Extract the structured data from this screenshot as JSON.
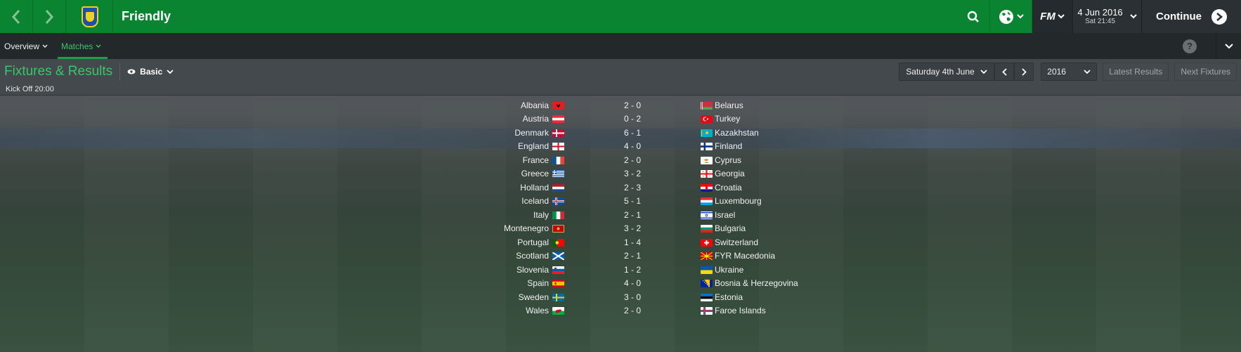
{
  "header": {
    "title": "Friendly",
    "brand": "FM",
    "date": "4 Jun 2016",
    "day_time": "Sat 21:45",
    "continue_label": "Continue",
    "accent": "#0a8431"
  },
  "subnav": {
    "tabs": [
      {
        "label": "Overview",
        "active": false
      },
      {
        "label": "Matches",
        "active": true
      }
    ],
    "help": "?"
  },
  "toolbar": {
    "title": "Fixtures & Results",
    "view_label": "Basic",
    "date_select": "Saturday 4th June",
    "year_select": "2016",
    "latest_results": "Latest Results",
    "next_fixtures": "Next Fixtures"
  },
  "kickoff_label": "Kick Off 20:00",
  "fixtures": [
    {
      "home": "Albania",
      "home_flag": "albania",
      "score": "2 - 0",
      "away": "Belarus",
      "away_flag": "belarus"
    },
    {
      "home": "Austria",
      "home_flag": "austria",
      "score": "0 - 2",
      "away": "Turkey",
      "away_flag": "turkey"
    },
    {
      "home": "Denmark",
      "home_flag": "denmark",
      "score": "6 - 1",
      "away": "Kazakhstan",
      "away_flag": "kazakhstan"
    },
    {
      "home": "England",
      "home_flag": "england",
      "score": "4 - 0",
      "away": "Finland",
      "away_flag": "finland"
    },
    {
      "home": "France",
      "home_flag": "france",
      "score": "2 - 0",
      "away": "Cyprus",
      "away_flag": "cyprus"
    },
    {
      "home": "Greece",
      "home_flag": "greece",
      "score": "3 - 2",
      "away": "Georgia",
      "away_flag": "georgia"
    },
    {
      "home": "Holland",
      "home_flag": "holland",
      "score": "2 - 3",
      "away": "Croatia",
      "away_flag": "croatia"
    },
    {
      "home": "Iceland",
      "home_flag": "iceland",
      "score": "5 - 1",
      "away": "Luxembourg",
      "away_flag": "luxembourg"
    },
    {
      "home": "Italy",
      "home_flag": "italy",
      "score": "2 - 1",
      "away": "Israel",
      "away_flag": "israel"
    },
    {
      "home": "Montenegro",
      "home_flag": "montenegro",
      "score": "3 - 2",
      "away": "Bulgaria",
      "away_flag": "bulgaria"
    },
    {
      "home": "Portugal",
      "home_flag": "portugal",
      "score": "1 - 4",
      "away": "Switzerland",
      "away_flag": "switzerland"
    },
    {
      "home": "Scotland",
      "home_flag": "scotland",
      "score": "2 - 1",
      "away": "FYR Macedonia",
      "away_flag": "macedonia"
    },
    {
      "home": "Slovenia",
      "home_flag": "slovenia",
      "score": "1 - 2",
      "away": "Ukraine",
      "away_flag": "ukraine"
    },
    {
      "home": "Spain",
      "home_flag": "spain",
      "score": "4 - 0",
      "away": "Bosnia & Herzegovina",
      "away_flag": "bosnia"
    },
    {
      "home": "Sweden",
      "home_flag": "sweden",
      "score": "3 - 0",
      "away": "Estonia",
      "away_flag": "estonia"
    },
    {
      "home": "Wales",
      "home_flag": "wales",
      "score": "2 - 0",
      "away": "Faroe Islands",
      "away_flag": "faroe"
    }
  ]
}
